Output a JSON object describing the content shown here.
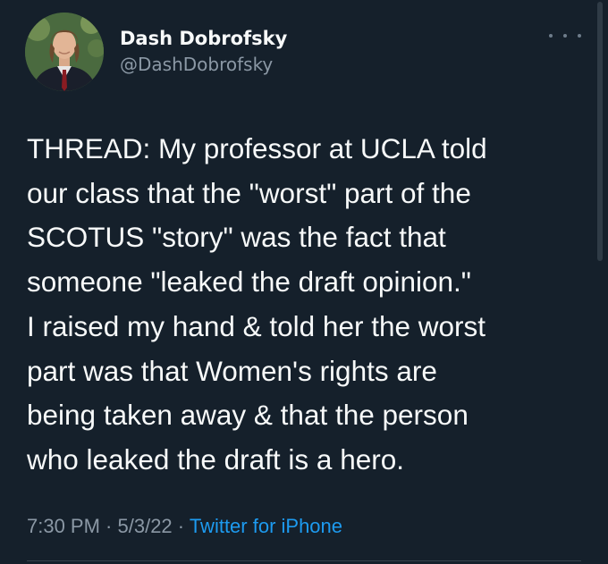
{
  "author": {
    "display_name": "Dash Dobrofsky",
    "handle": "@DashDobrofsky"
  },
  "more_icon": "more-horizontal-icon",
  "tweet": {
    "lines": [
      "THREAD: My professor at UCLA told",
      "our class that the \"worst\" part of the",
      "SCOTUS \"story\" was the fact that",
      "someone \"leaked the draft opinion.\"",
      "I raised my hand & told her the worst",
      "part was that Women's rights are",
      "being taken away & that the person",
      "who leaked the draft is a hero."
    ]
  },
  "meta": {
    "time": "7:30 PM",
    "separator": " · ",
    "date": "5/3/22",
    "source": "Twitter for iPhone"
  },
  "colors": {
    "background": "#15202b",
    "text": "#f7f9f9",
    "secondary": "#8b98a5",
    "link": "#1d9bf0"
  }
}
